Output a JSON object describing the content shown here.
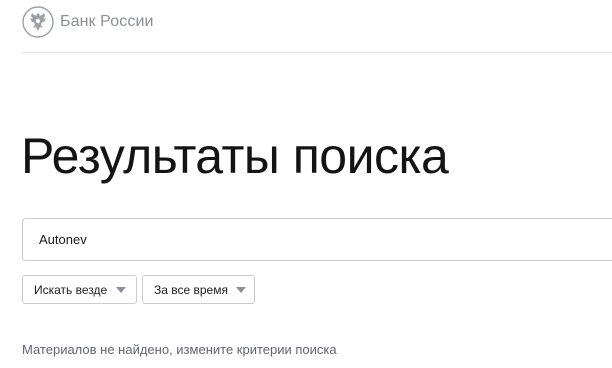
{
  "header": {
    "brand_name": "Банк России",
    "logo_icon": "double-headed-eagle-emblem"
  },
  "main": {
    "title": "Результаты поиска",
    "search": {
      "value": "Autonev",
      "placeholder": ""
    },
    "filters": [
      {
        "label": "Искать везде",
        "icon": "chevron-down-icon"
      },
      {
        "label": "За все время",
        "icon": "chevron-down-icon"
      }
    ],
    "empty_message": "Материалов не найдено, измените критерии поиска"
  },
  "colors": {
    "text_primary": "#141414",
    "text_muted": "#8a8f99",
    "border": "#c9cdd3",
    "divider": "#e3e5e8"
  }
}
